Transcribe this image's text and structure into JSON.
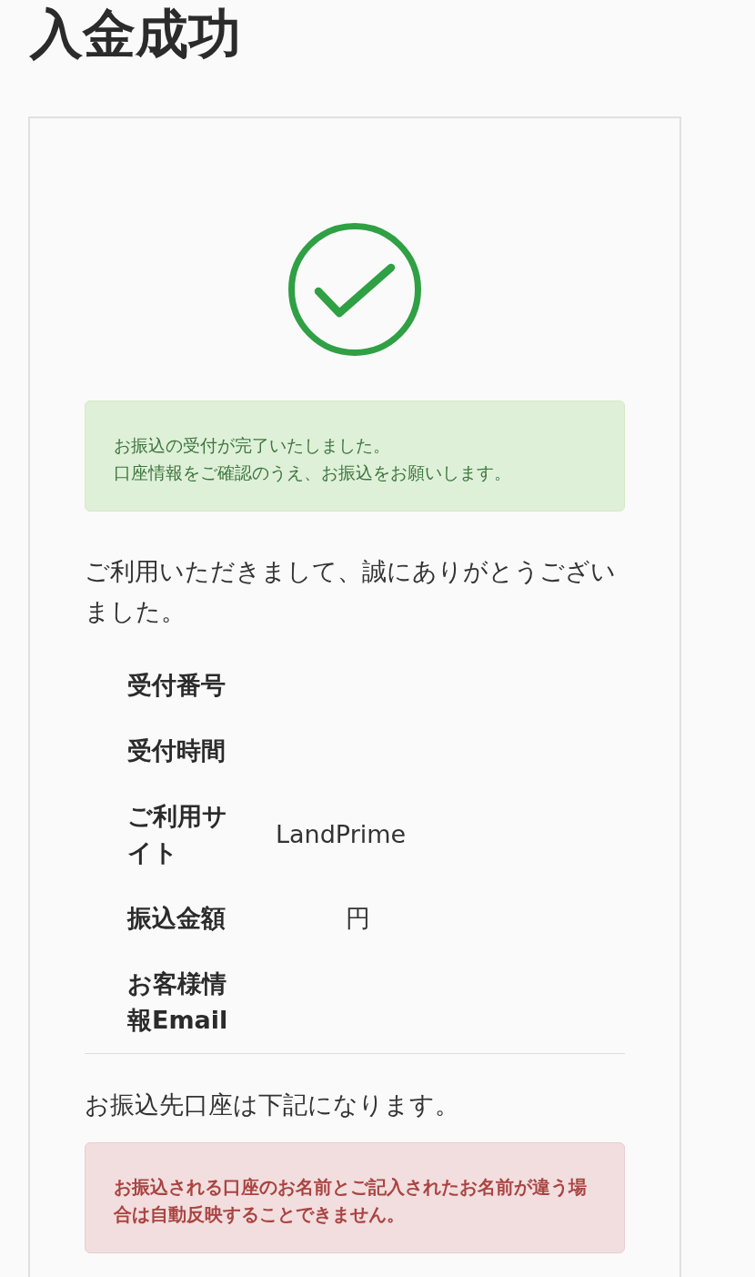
{
  "page": {
    "title": "入金成功"
  },
  "success_alert": {
    "kind": "success",
    "lines": [
      "お振込の受付が完了いたしました。",
      "口座情報をご確認のうえ、お振込をお願いします。"
    ]
  },
  "thanks": "ご利用いただきまして、誠にありがとうございました。",
  "details": [
    {
      "label": "受付番号"
    },
    {
      "label": "受付時間"
    },
    {
      "label": "ご利用サイト",
      "value": "LandPrime"
    },
    {
      "label": "振込金額",
      "unit": "円"
    },
    {
      "label": "お客様情報Email"
    }
  ],
  "account_intro": "お振込先口座は下記になります。",
  "warning_alert": {
    "kind": "danger",
    "lines": [
      "お振込される口座のお名前とご記入されたお名前が違う場合は自動反映することできません。"
    ]
  }
}
